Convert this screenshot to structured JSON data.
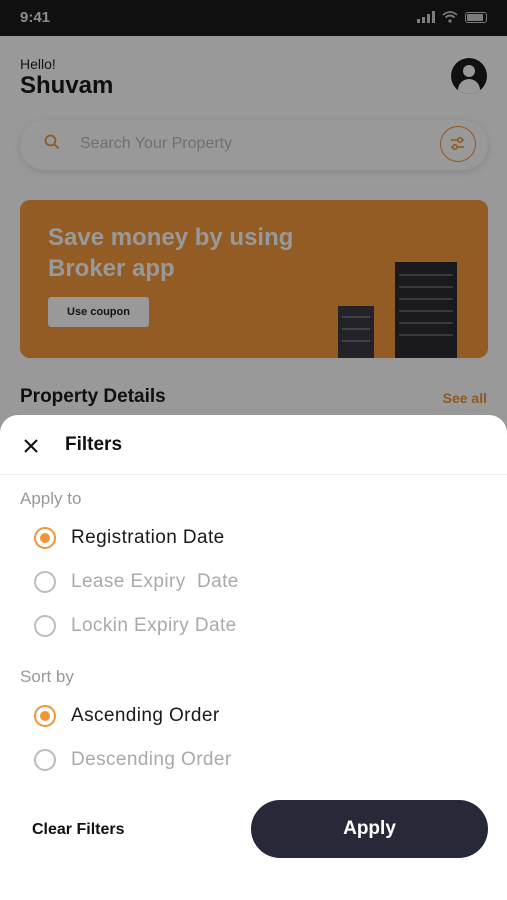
{
  "status_bar": {
    "time": "9:41"
  },
  "home": {
    "greeting": "Hello!",
    "user_name": "Shuvam",
    "search_placeholder": "Search Your Property",
    "banner": {
      "title": "Save money by using Broker app",
      "button_label": "Use coupon"
    },
    "section_title": "Property Details",
    "see_all_label": "See all"
  },
  "filters": {
    "title": "Filters",
    "apply_to": {
      "label": "Apply to",
      "options": [
        {
          "label": "Registration Date",
          "selected": true
        },
        {
          "label": "Lease Expiry  Date",
          "selected": false
        },
        {
          "label": "Lockin Expiry Date",
          "selected": false
        }
      ]
    },
    "sort_by": {
      "label": "Sort by",
      "options": [
        {
          "label": "Ascending Order",
          "selected": true
        },
        {
          "label": "Descending Order",
          "selected": false
        }
      ]
    },
    "clear_label": "Clear Filters",
    "apply_label": "Apply"
  },
  "colors": {
    "accent": "#f0953a",
    "dark": "#272838",
    "banner": "#f39a3c"
  }
}
